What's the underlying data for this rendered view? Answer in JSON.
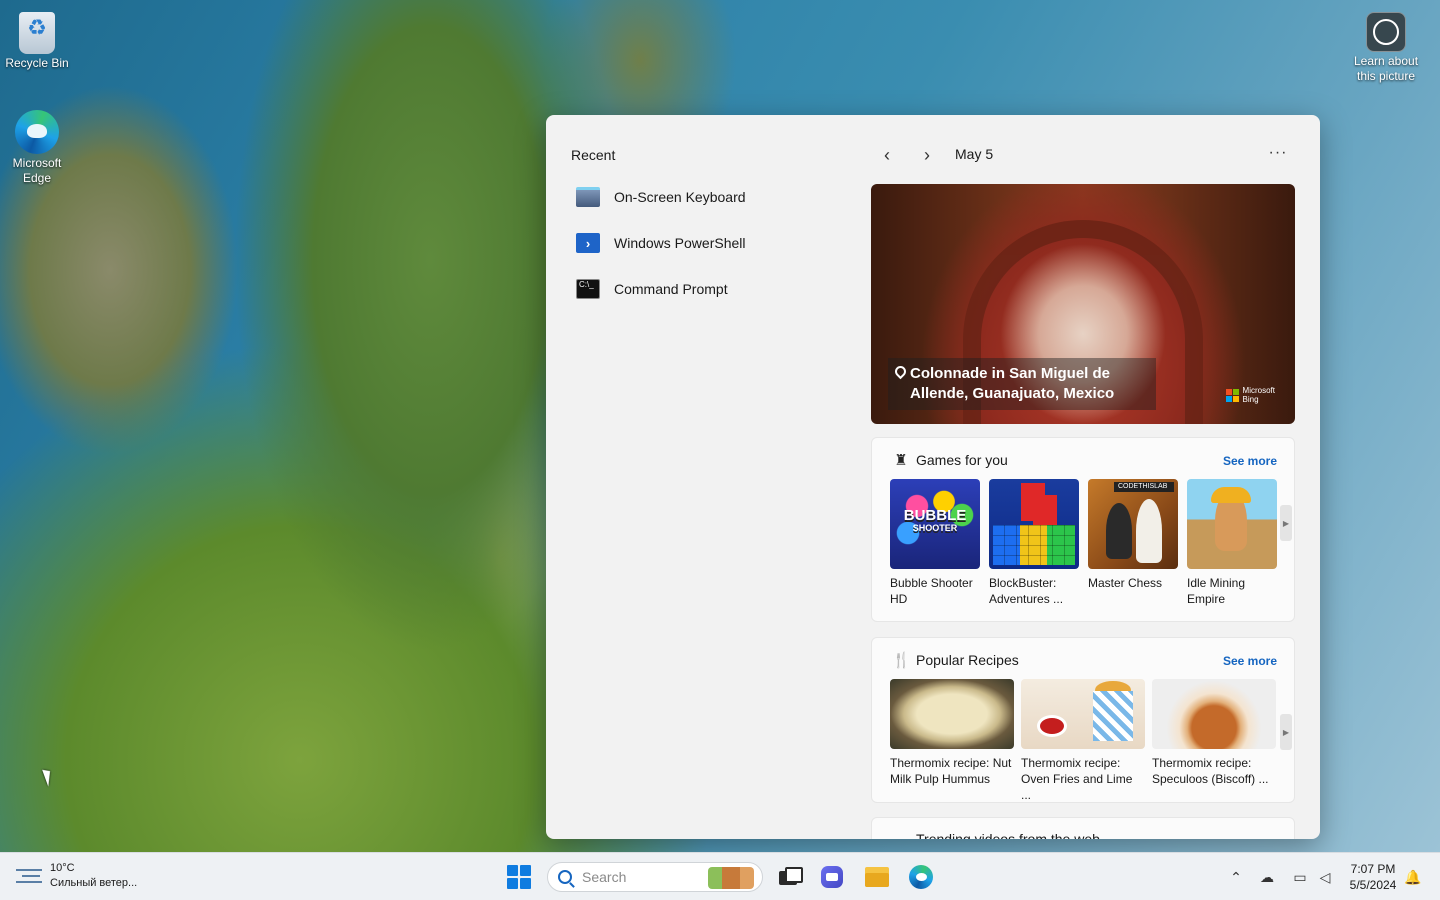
{
  "desktop": {
    "icons": [
      {
        "label": "Recycle Bin"
      },
      {
        "label": "Microsoft Edge"
      },
      {
        "label": "Learn about this picture"
      }
    ]
  },
  "start": {
    "recent": {
      "title": "Recent",
      "items": [
        {
          "label": "On-Screen Keyboard",
          "icon": "keyboard-icon"
        },
        {
          "label": "Windows PowerShell",
          "icon": "powershell-icon"
        },
        {
          "label": "Command Prompt",
          "icon": "command-prompt-icon"
        }
      ]
    },
    "feed": {
      "date": "May 5",
      "more_label": "···",
      "hero": {
        "caption": "Colonnade in San Miguel de Allende, Guanajuato, Mexico",
        "brand_line1": "Microsoft",
        "brand_line2": "Bing"
      },
      "games": {
        "title": "Games for you",
        "see_more": "See more",
        "items": [
          {
            "label": "Bubble Shooter HD",
            "thumb_text": "BUBBLE",
            "thumb_sub": "SHOOTER"
          },
          {
            "label": "BlockBuster: Adventures ..."
          },
          {
            "label": "Master Chess",
            "thumb_text": "CODETHISLAB"
          },
          {
            "label": "Idle Mining Empire"
          }
        ]
      },
      "recipes": {
        "title": "Popular Recipes",
        "see_more": "See more",
        "items": [
          {
            "label": "Thermomix recipe: Nut Milk Pulp Hummus"
          },
          {
            "label": "Thermomix recipe: Oven Fries and Lime ..."
          },
          {
            "label": "Thermomix recipe: Speculoos (Biscoff) ..."
          }
        ]
      },
      "trending_title": "Trending videos from the web"
    }
  },
  "taskbar": {
    "weather": {
      "temp": "10°C",
      "desc": "Сильный ветер..."
    },
    "search": {
      "placeholder": "Search"
    },
    "clock": {
      "time": "7:07 PM",
      "date": "5/5/2024"
    }
  },
  "colors": {
    "accent": "#0f7ce0",
    "link": "#1565c0",
    "panel": "#f2f2f2",
    "taskbar": "#eef1f4"
  }
}
